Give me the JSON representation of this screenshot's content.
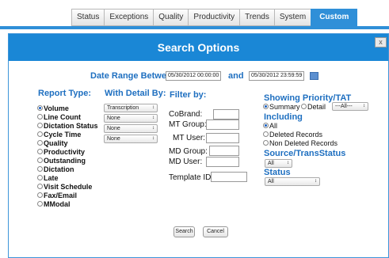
{
  "tabs": [
    {
      "label": "Status"
    },
    {
      "label": "Exceptions"
    },
    {
      "label": "Quality"
    },
    {
      "label": "Productivity"
    },
    {
      "label": "Trends"
    },
    {
      "label": "System"
    },
    {
      "label": "Custom"
    }
  ],
  "modal": {
    "title": "Search Options",
    "close_label": "x"
  },
  "date_range": {
    "label": "Date Range Between",
    "start": "05/30/2012 00:00:00",
    "and_label": "and",
    "end": "05/30/2012 23:59:59"
  },
  "report_type": {
    "heading": "Report Type:",
    "options": [
      "Volume",
      "Line Count",
      "Dictation Status",
      "Cycle Time",
      "Quality",
      "Productivity",
      "Outstanding",
      "Dictation",
      "Late",
      "Visit Schedule",
      "Fax/Email",
      "MModal"
    ]
  },
  "detail": {
    "heading": "With Detail By:",
    "selects": [
      "Transcription",
      "None",
      "None",
      "None"
    ]
  },
  "filter": {
    "heading": "Filter by:",
    "cobrand": "CoBrand:",
    "mt_group": "MT Group:",
    "mt_user": "MT User:",
    "md_group": "MD Group:",
    "md_user": "MD User:",
    "template_id": "Template ID:"
  },
  "priority": {
    "heading": "Showing Priority/TAT",
    "summary": "Summary",
    "detail": "Detail",
    "detail_select": "---All---"
  },
  "including": {
    "heading": "Including",
    "options": [
      "All",
      "Deleted Records",
      "Non Deleted Records"
    ]
  },
  "source": {
    "heading": "Source/TransStatus",
    "select": "All"
  },
  "status": {
    "heading": "Status",
    "select": "All"
  },
  "buttons": {
    "search": "Search",
    "cancel": "Cancel"
  },
  "colors": {
    "accent": "#1a87d6",
    "heading_blue": "#1e6fc0"
  }
}
